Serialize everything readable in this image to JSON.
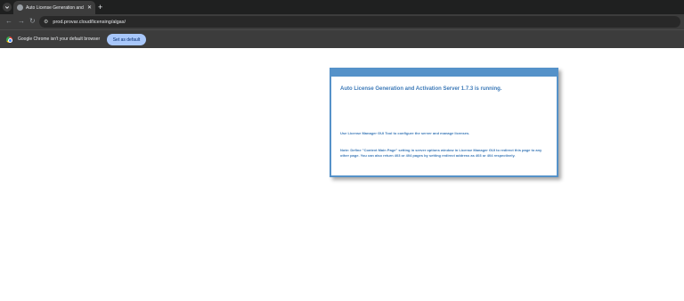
{
  "browser": {
    "tab": {
      "title": "Auto License Generation and A",
      "close_glyph": "✕"
    },
    "new_tab_glyph": "+",
    "url": "prod.provar.cloud/licensing/algas/",
    "infobar": {
      "message": "Google Chrome isn't your default browser",
      "button_label": "Set as default"
    }
  },
  "page": {
    "title": "Auto License Generation and Activation Server 1.7.3 is running.",
    "message1": "Use License Manager GUI Tool to configure the server and manage licenses.",
    "message2": "Note: Define \"Context Main Page\" setting in server options window in License Manager GUI to redirect this page to any other page. You can also return 403 or 404 pages by setting redirect address as 403 or 404 respectively."
  },
  "colors": {
    "accent": "#5592c9",
    "text": "#3d7ab8",
    "set_default_button": "#a8c7fa"
  }
}
